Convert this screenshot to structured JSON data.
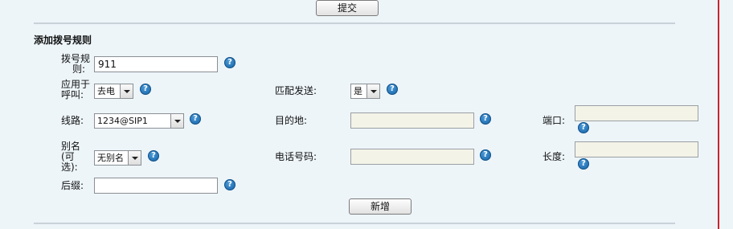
{
  "buttons": {
    "submit": "提交",
    "add": "新增"
  },
  "section": {
    "title": "添加拨号规则"
  },
  "fields": {
    "dial_rule": {
      "label_l1": "拨号规",
      "label_l2": "则:",
      "value": "911"
    },
    "apply_to": {
      "label_l1": "应用于",
      "label_l2": "呼叫:",
      "value": "去电"
    },
    "match_send": {
      "label": "匹配发送:",
      "value": "是"
    },
    "line": {
      "label": "线路:",
      "value": "1234@SIP1"
    },
    "destination": {
      "label": "目的地:",
      "value": ""
    },
    "port": {
      "label": "端口:",
      "value": ""
    },
    "alias": {
      "label_l1": "别名",
      "label_l2": "(可",
      "label_l3": "选):",
      "value": "无别名"
    },
    "phone_number": {
      "label": "电话号码:",
      "value": ""
    },
    "length": {
      "label": "长度:",
      "value": ""
    },
    "suffix": {
      "label": "后缀:",
      "value": ""
    }
  },
  "icons": {
    "help": "help-question-icon",
    "help_glyph": "?"
  },
  "colors": {
    "background": "#edf5f9",
    "help_icon": "#1664a8",
    "right_border": "#c8242a"
  }
}
